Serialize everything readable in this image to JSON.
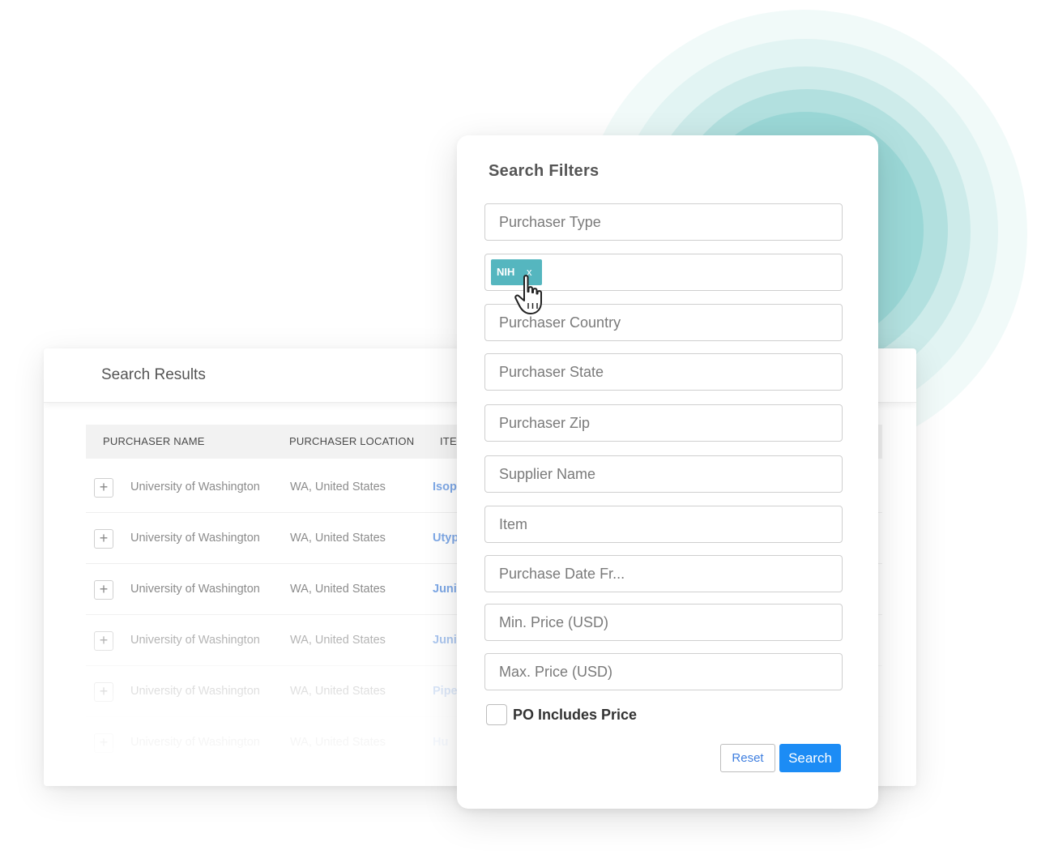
{
  "colors": {
    "accent_teal": "#55b6bf",
    "primary_blue": "#1c8cf5",
    "item_link": "#7ea8e6"
  },
  "results": {
    "title": "Search Results",
    "columns": [
      "PURCHASER NAME",
      "PURCHASER LOCATION",
      "ITE"
    ],
    "rows": [
      {
        "name": "University of Washington",
        "location": "WA, United States",
        "item": "Isop"
      },
      {
        "name": "University of Washington",
        "location": "WA, United States",
        "item": "Utyp"
      },
      {
        "name": "University of Washington",
        "location": "WA, United States",
        "item": "Juni"
      },
      {
        "name": "University of Washington",
        "location": "WA, United States",
        "item": "Juni"
      },
      {
        "name": "University of Washington",
        "location": "WA, United States",
        "item": "Pipe"
      },
      {
        "name": "University of Washington",
        "location": "WA, United States",
        "item": "Hu"
      }
    ],
    "expand_glyph": "+"
  },
  "filters": {
    "title": "Search Filters",
    "fields": [
      {
        "placeholder": "Purchaser Type"
      },
      {
        "placeholder": "Purchaser Country"
      },
      {
        "placeholder": "Purchaser State"
      },
      {
        "placeholder": "Purchaser Zip"
      },
      {
        "placeholder": "Supplier Name"
      },
      {
        "placeholder": "Item"
      },
      {
        "placeholder": "Purchase Date Fr..."
      },
      {
        "placeholder": "Min. Price (USD)"
      },
      {
        "placeholder": "Max. Price (USD)"
      }
    ],
    "tag": {
      "label": "NIH",
      "close": "x"
    },
    "checkbox_label": "PO Includes Price",
    "reset_label": "Reset",
    "search_label": "Search"
  }
}
